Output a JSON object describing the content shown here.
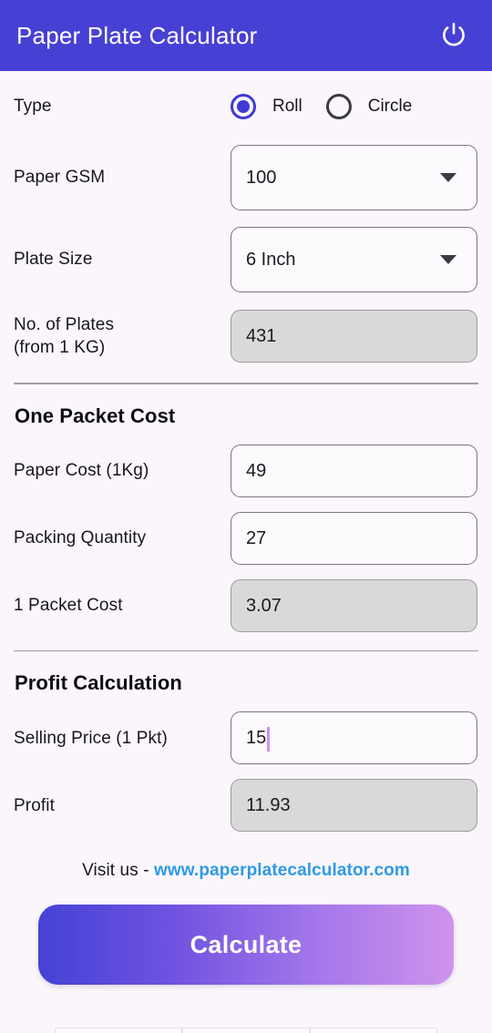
{
  "header": {
    "title": "Paper Plate Calculator",
    "power_icon": "power-icon"
  },
  "form": {
    "type": {
      "label": "Type",
      "options": [
        {
          "label": "Roll",
          "selected": true
        },
        {
          "label": "Circle",
          "selected": false
        }
      ]
    },
    "paper_gsm": {
      "label": "Paper GSM",
      "value": "100",
      "icon": "chevron-down-icon"
    },
    "plate_size": {
      "label": "Plate Size",
      "value": "6 Inch",
      "icon": "chevron-down-icon"
    },
    "no_of_plates": {
      "label_line1": "No. of Plates",
      "label_line2": "(from 1 KG)",
      "value": "431",
      "readonly": true
    }
  },
  "one_packet_cost": {
    "title": "One Packet Cost",
    "paper_cost": {
      "label": "Paper Cost (1Kg)",
      "value": "49"
    },
    "packing_quantity": {
      "label": "Packing Quantity",
      "value": "27"
    },
    "packet_cost": {
      "label": "1 Packet Cost",
      "value": "3.07",
      "readonly": true
    }
  },
  "profit_calculation": {
    "title": "Profit Calculation",
    "selling_price": {
      "label": "Selling Price (1 Pkt)",
      "value": "15",
      "focused": true
    },
    "profit": {
      "label": "Profit",
      "value": "11.93",
      "readonly": true
    }
  },
  "footer": {
    "visit_prefix": "Visit us - ",
    "link_text": "www.paperplatecalculator.com",
    "calculate_label": "Calculate"
  },
  "colors": {
    "header_bg": "#4740d4",
    "page_bg": "#fbf6fb",
    "accent": "#3f3ad6",
    "readonly_bg": "#d9d9d9",
    "link": "#2e9ae6",
    "caret": "#cf8ef0",
    "button_gradient_start": "#4442d6",
    "button_gradient_end": "#cf93ec"
  }
}
